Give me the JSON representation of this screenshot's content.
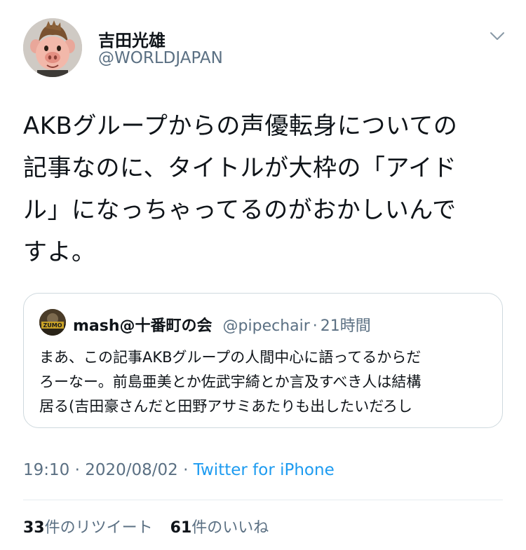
{
  "author": {
    "name": "吉田光雄",
    "handle": "@WORLDJAPAN"
  },
  "tweet": {
    "lines": [
      "AKBグループからの声優転身についての",
      "記事なのに、タイトルが大枠の「アイド",
      "ル」になっちゃってるのがおかしいんで",
      "すよ。"
    ]
  },
  "quoted": {
    "name": "mash@十番町の会",
    "handle": "@pipechair",
    "separator": "·",
    "time": "21時間",
    "avatar_text": "ZUMO",
    "lines": [
      "まあ、この記事AKBグループの人間中心に語ってるからだ",
      "ろーなー。前島亜美とか佐武宇綺とか言及すべき人は結構",
      "居る(吉田豪さんだと田野アサミあたりも出したいだろし"
    ]
  },
  "meta": {
    "time": "19:10",
    "separator": "·",
    "date": "2020/08/02",
    "source": "Twitter for iPhone"
  },
  "stats": {
    "retweets": "33",
    "retweets_label": "件のリツイート",
    "likes": "61",
    "likes_label": "件のいいね"
  },
  "icons": {
    "menu": "chevron-down-icon",
    "avatar": "pig-character-avatar"
  },
  "colors": {
    "link": "#1d9bf0",
    "secondary_text": "#5b7083",
    "border": "#cfd9de"
  }
}
